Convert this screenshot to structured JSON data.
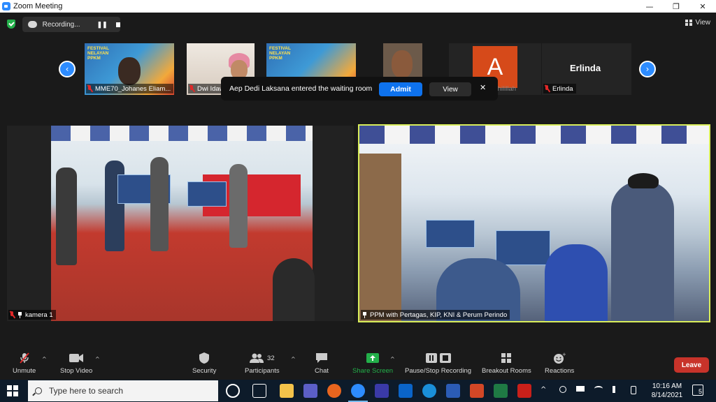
{
  "window": {
    "title": "Zoom Meeting",
    "minimize": "—",
    "maximize": "❐",
    "close": "✕"
  },
  "top": {
    "recording_text": "Recording...",
    "pause_glyph": "❚❚",
    "view_label": "View"
  },
  "thumbnails": [
    {
      "name": "MME70_Johanes Eliam...",
      "banner_text": "FESTIVAL NELAYAN PPKM"
    },
    {
      "name": "Dwi Idawati"
    },
    {
      "name": "",
      "banner_text": "FESTIVAL NELAYAN PPKM"
    },
    {
      "name": ""
    },
    {
      "name": "Arghaa Fadhilillah",
      "initial": "A"
    },
    {
      "name": "Erlinda",
      "tile_text": "Erlinda"
    }
  ],
  "nav": {
    "prev": "‹",
    "next": "›"
  },
  "toast": {
    "message": "Aep Dedi Laksana entered the waiting room",
    "admit": "Admit",
    "view": "View",
    "close": "✕"
  },
  "videos": [
    {
      "name": "kamera 1"
    },
    {
      "name": "PPM with Pertagas, KIP, KNI & Perum Perindo"
    }
  ],
  "toolbar": {
    "unmute": "Unmute",
    "stop_video": "Stop Video",
    "security": "Security",
    "participants": "Participants",
    "participant_count": "32",
    "chat": "Chat",
    "share_screen": "Share Screen",
    "recording": "Pause/Stop Recording",
    "breakout": "Breakout Rooms",
    "reactions": "Reactions",
    "leave": "Leave",
    "caret": "^"
  },
  "taskbar": {
    "search_placeholder": "Type here to search",
    "time": "10:16 AM",
    "date": "8/14/2021",
    "notifications": "5",
    "tray_chevron": "^"
  },
  "colors": {
    "zoom_blue": "#2d8cff",
    "admit_blue": "#0e72ed",
    "leave_red": "#c8332a",
    "active_speaker": "#d9ee5a",
    "share_green": "#23b04a"
  }
}
